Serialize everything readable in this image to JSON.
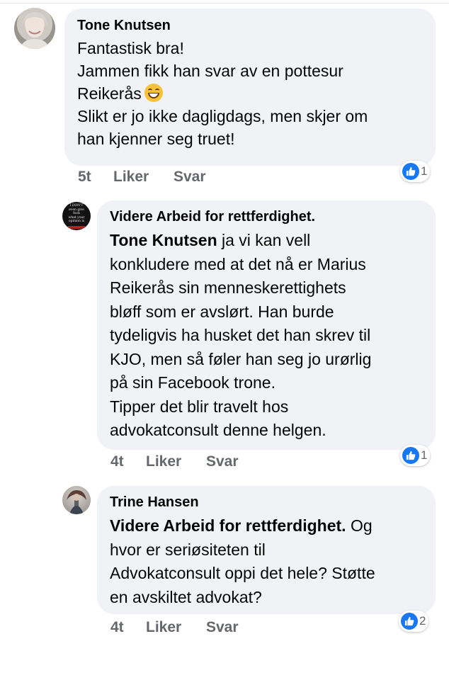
{
  "comments": [
    {
      "author": "Tone Knutsen",
      "lines": [
        "Fantastisk bra!",
        "Jammen fikk han svar av en pottesur",
        "Reikerås",
        "Slikt er jo ikke dagligdags, men skjer om",
        "han kjenner seg truet!"
      ],
      "emoji": "grinning-face-emoji",
      "time": "5t",
      "like_label": "Liker",
      "reply_label": "Svar",
      "reaction_count": "1"
    },
    {
      "author": "Videre Arbeid for rettferdighet.",
      "mention": "Tone Knutsen",
      "lines": [
        " ja vi kan vell",
        "konkludere med at det nå er Marius",
        "Reikerås sin menneskerettighets",
        "bløff som er avslørt. Han burde",
        "tydeligvis ha husket det han skrev til",
        "KJO, men så føler han seg jo urørlig",
        "på sin Facebook trone.",
        "Tipper det blir travelt hos",
        "advokatconsult denne helgen."
      ],
      "avatar_text": [
        "I DON'T",
        "even give",
        "fuck",
        "what your",
        "opinion is"
      ],
      "time": "4t",
      "like_label": "Liker",
      "reply_label": "Svar",
      "reaction_count": "1"
    },
    {
      "author": "Trine Hansen",
      "mention": "Videre Arbeid for rettferdighet.",
      "lines": [
        " Og",
        "hvor er seriøsiteten til",
        "Advokatconsult oppi det hele? Støtte",
        "en avskiltet advokat?"
      ],
      "time": "4t",
      "like_label": "Liker",
      "reply_label": "Svar",
      "reaction_count": "2"
    }
  ],
  "colors": {
    "bubble": "#f0f2f5",
    "meta_text": "#65676b",
    "like_blue": "#1877f2"
  }
}
